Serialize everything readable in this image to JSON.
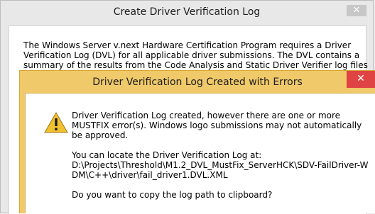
{
  "background_dialog": {
    "title": "Create Driver Verification Log",
    "close_glyph": "✕",
    "body_text": "The Windows Server v.next Hardware Certification Program requires a Driver Verification Log (DVL) for all applicable driver submissions. The DVL contains a summary of the results from the Code Analysis and Static Driver Verifier log files without source"
  },
  "error_dialog": {
    "title": "Driver Verification Log Created with Errors",
    "close_glyph": "✕",
    "icon": "warning-icon",
    "message": "Driver Verification Log created, however there are one or more MUSTFIX error(s). Windows logo submissions may not automatically be approved.",
    "locate_label": "You can locate the Driver Verification Log at:",
    "log_path": "D:\\Projects\\Threshold\\M1.2_DVL_MustFix_ServerHCK\\SDV-FailDriver-WDM\\C++\\driver\\fail_driver1.DVL.XML",
    "question": "Do you want to copy the log path to clipboard?"
  },
  "colors": {
    "accent_frame": "#f0c96a",
    "close_button": "#e04343",
    "warning_fill": "#f2c12e"
  }
}
